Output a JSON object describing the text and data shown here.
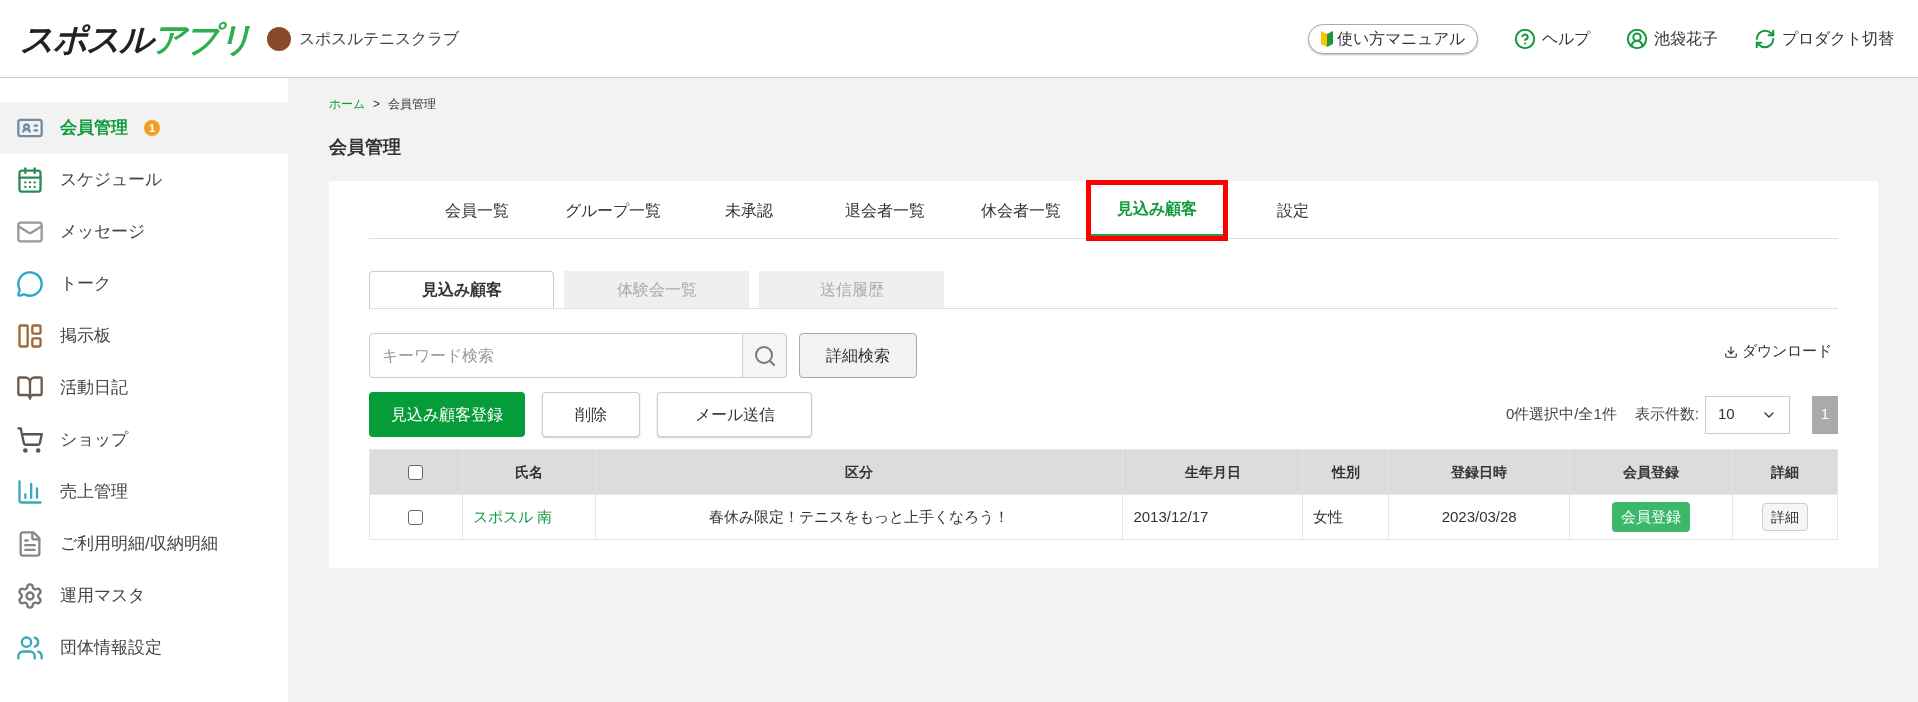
{
  "header": {
    "logo": {
      "part1": "スポスル",
      "part2": "アプリ"
    },
    "club_name": "スポスルテニスクラブ",
    "links": [
      {
        "kind": "manual",
        "label": "使い方マニュアル"
      },
      {
        "kind": "help",
        "label": "ヘルプ"
      },
      {
        "kind": "user",
        "label": "池袋花子"
      },
      {
        "kind": "switch",
        "label": "プロダクト切替"
      }
    ]
  },
  "sidebar": {
    "items": [
      {
        "kind": "id",
        "label": "会員管理",
        "selected": true,
        "badge": "1"
      },
      {
        "kind": "calendar",
        "label": "スケジュール",
        "selected": false
      },
      {
        "kind": "mail",
        "label": "メッセージ",
        "selected": false
      },
      {
        "kind": "chat",
        "label": "トーク",
        "selected": false
      },
      {
        "kind": "board",
        "label": "掲示板",
        "selected": false
      },
      {
        "kind": "diary",
        "label": "活動日記",
        "selected": false
      },
      {
        "kind": "cart",
        "label": "ショップ",
        "selected": false
      },
      {
        "kind": "sales",
        "label": "売上管理",
        "selected": false
      },
      {
        "kind": "receipt",
        "label": "ご利用明細/収納明細",
        "selected": false
      },
      {
        "kind": "gear",
        "label": "運用マスタ",
        "selected": false
      },
      {
        "kind": "group",
        "label": "団体情報設定",
        "selected": false
      }
    ]
  },
  "breadcrumb": [
    {
      "label": "ホーム",
      "link": true
    },
    {
      "label": ">",
      "link": false
    },
    {
      "label": "会員管理",
      "link": false
    }
  ],
  "page_title": "会員管理",
  "tabs": [
    {
      "label": "会員一覧",
      "selected": false,
      "highlighted": false
    },
    {
      "label": "グループ一覧",
      "selected": false,
      "highlighted": false
    },
    {
      "label": "未承認",
      "selected": false,
      "highlighted": false
    },
    {
      "label": "退会者一覧",
      "selected": false,
      "highlighted": false
    },
    {
      "label": "休会者一覧",
      "selected": false,
      "highlighted": false
    },
    {
      "label": "見込み顧客",
      "selected": true,
      "highlighted": true
    },
    {
      "label": "設定",
      "selected": false,
      "highlighted": false
    }
  ],
  "subtabs": [
    {
      "label": "見込み顧客",
      "selected": true
    },
    {
      "label": "体験会一覧",
      "selected": false
    },
    {
      "label": "送信履歴",
      "selected": false
    }
  ],
  "search": {
    "placeholder": "キーワード検索",
    "advanced_button": "詳細検索"
  },
  "download": "ダウンロード",
  "actions": [
    {
      "label": "見込み顧客登録",
      "kind": "primary"
    },
    {
      "label": "削除",
      "kind": "default"
    },
    {
      "label": "メール送信",
      "kind": "default"
    }
  ],
  "selection_info": "0件選択中/全1件",
  "page_size": {
    "label": "表示件数:",
    "value": "10"
  },
  "pagination": [
    {
      "label": "1",
      "selected": true
    }
  ],
  "table": {
    "select_all_checked": false,
    "columns": [
      "氏名",
      "区分",
      "生年月日",
      "性別",
      "登録日時",
      "会員登録",
      "詳細"
    ],
    "rows": [
      {
        "checked": false,
        "name": "スポスル 南",
        "category": "春休み限定！テニスをもっと上手くなろう！",
        "birthdate": "2013/12/17",
        "gender": "女性",
        "registered": "2023/03/28",
        "register_button": "会員登録",
        "detail_button": "詳細"
      }
    ]
  }
}
